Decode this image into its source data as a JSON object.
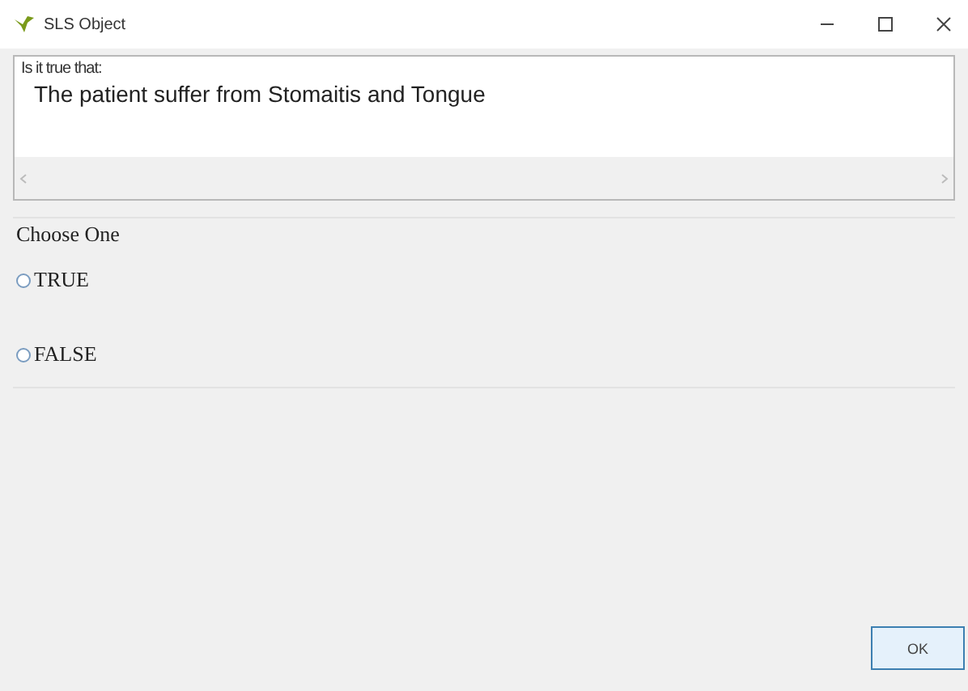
{
  "window": {
    "title": "SLS Object"
  },
  "question": {
    "prompt": "Is it true that:",
    "statement": "The patient suffer from Stomaitis and Tongue"
  },
  "choices": {
    "label": "Choose One",
    "options": [
      {
        "label": "TRUE",
        "selected": false
      },
      {
        "label": "FALSE",
        "selected": false
      }
    ]
  },
  "buttons": [
    "OK"
  ]
}
